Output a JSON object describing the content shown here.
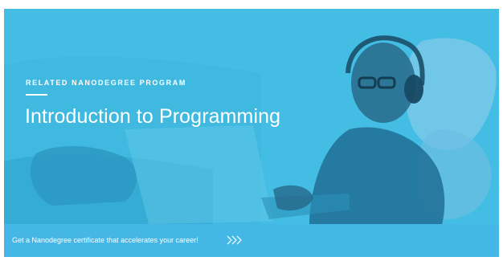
{
  "banner": {
    "eyebrow": "RELATED NANODEGREE PROGRAM",
    "title": "Introduction to Programming",
    "footer_text": "Get a Nanodegree certificate that accelerates your career!",
    "cta_icon": "triple-chevron-right-icon",
    "colors": {
      "overlay": "#3fb8de",
      "footer": "#44b7e6",
      "text": "#ffffff"
    }
  }
}
